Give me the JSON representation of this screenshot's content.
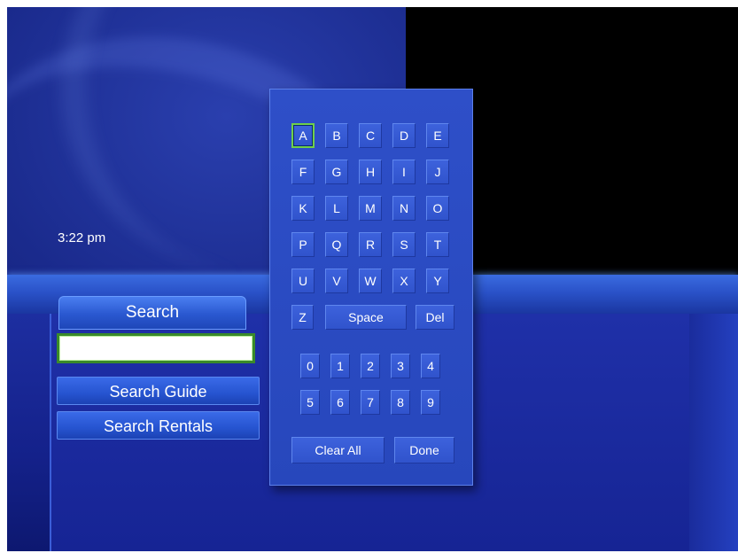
{
  "clock": "3:22 pm",
  "search_tab": "Search",
  "search_input": {
    "value": ""
  },
  "menu": [
    "Search Guide",
    "Search Rentals"
  ],
  "keyboard": {
    "letter_rows": [
      [
        "A",
        "B",
        "C",
        "D",
        "E"
      ],
      [
        "F",
        "G",
        "H",
        "I",
        "J"
      ],
      [
        "K",
        "L",
        "M",
        "N",
        "O"
      ],
      [
        "P",
        "Q",
        "R",
        "S",
        "T"
      ],
      [
        "U",
        "V",
        "W",
        "X",
        "Y"
      ]
    ],
    "special_row": {
      "z": "Z",
      "space": "Space",
      "del": "Del"
    },
    "number_rows": [
      [
        "0",
        "1",
        "2",
        "3",
        "4"
      ],
      [
        "5",
        "6",
        "7",
        "8",
        "9"
      ]
    ],
    "actions": {
      "clear_all": "Clear All",
      "done": "Done"
    },
    "selected_key": "A"
  },
  "colors": {
    "selection_outline": "#6fd04a",
    "background": "#1a2a8c"
  }
}
